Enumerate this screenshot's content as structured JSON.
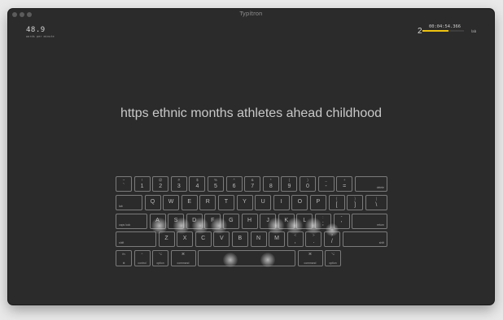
{
  "window": {
    "title": "Typitron"
  },
  "stats": {
    "wpm": "48.9",
    "wpm_label": "words per minute",
    "streak": "2",
    "timer": "00:04:54.366",
    "level": "lab",
    "progress": 0.62
  },
  "colors": {
    "progress": "#f1c40f",
    "background": "#2b2b2b"
  },
  "phrase": "https ethnic months athletes ahead childhood",
  "keyboard": {
    "row1": [
      {
        "s": "~",
        "m": "`"
      },
      {
        "s": "!",
        "m": "1"
      },
      {
        "s": "@",
        "m": "2"
      },
      {
        "s": "#",
        "m": "3"
      },
      {
        "s": "$",
        "m": "4"
      },
      {
        "s": "%",
        "m": "5"
      },
      {
        "s": "^",
        "m": "6"
      },
      {
        "s": "&",
        "m": "7"
      },
      {
        "s": "*",
        "m": "8"
      },
      {
        "s": "(",
        "m": "9"
      },
      {
        "s": ")",
        "m": "0"
      },
      {
        "s": "_",
        "m": "-"
      },
      {
        "s": "+",
        "m": "="
      }
    ],
    "delete": "delete",
    "tab": "tab",
    "row2": [
      "Q",
      "W",
      "E",
      "R",
      "T",
      "Y",
      "U",
      "I",
      "O",
      "P"
    ],
    "row2_sym": [
      {
        "s": "{",
        "m": "["
      },
      {
        "s": "}",
        "m": "]"
      },
      {
        "s": "|",
        "m": "\\"
      }
    ],
    "caps": "caps lock",
    "row3": [
      "A",
      "S",
      "D",
      "F",
      "G",
      "H",
      "J",
      "K",
      "L"
    ],
    "row3_sym": [
      {
        "s": ":",
        "m": ";"
      },
      {
        "s": "\"",
        "m": "'"
      }
    ],
    "return": "return",
    "shift_l": "shift",
    "row4": [
      "Z",
      "X",
      "C",
      "V",
      "B",
      "N",
      "M"
    ],
    "row4_sym": [
      {
        "s": "<",
        "m": ","
      },
      {
        "s": ">",
        "m": "."
      },
      {
        "s": "?",
        "m": "/"
      }
    ],
    "shift_r": "shift",
    "fn_top": "fn",
    "fn_bot": "⊕",
    "control": {
      "top": "^",
      "label": "control"
    },
    "option_l": {
      "top": "⌥",
      "label": "option"
    },
    "command_l": {
      "top": "⌘",
      "label": "command"
    },
    "command_r": {
      "top": "⌘",
      "label": "command"
    },
    "option_r": {
      "top": "⌥",
      "label": "option"
    }
  }
}
